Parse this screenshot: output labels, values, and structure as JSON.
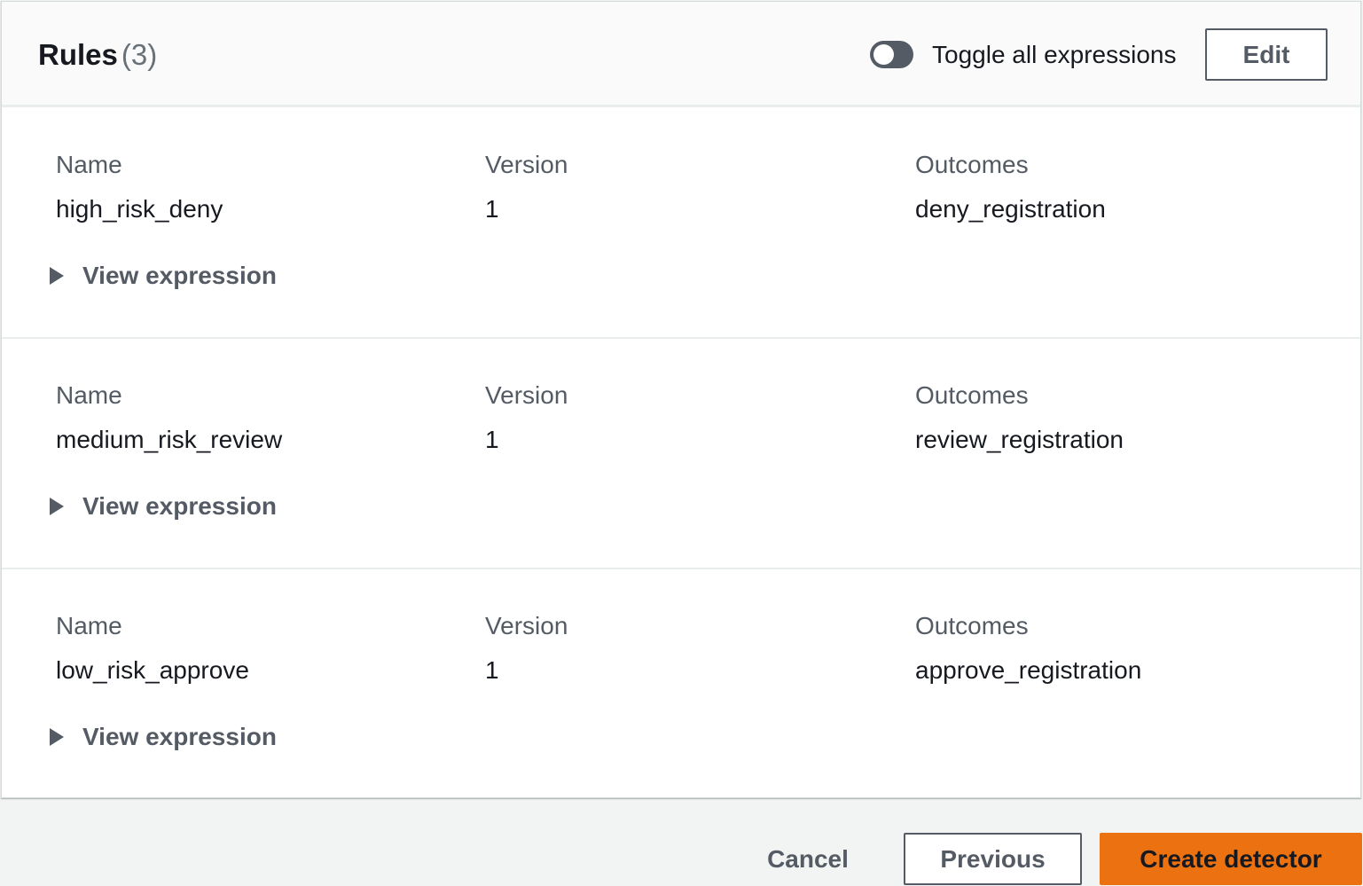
{
  "panel": {
    "title": "Rules",
    "count": "(3)",
    "toggle_label": "Toggle all expressions",
    "toggle_on": false,
    "edit_label": "Edit"
  },
  "rules": [
    {
      "name_label": "Name",
      "name": "high_risk_deny",
      "version_label": "Version",
      "version": "1",
      "outcomes_label": "Outcomes",
      "outcomes": "deny_registration",
      "expander_label": "View expression"
    },
    {
      "name_label": "Name",
      "name": "medium_risk_review",
      "version_label": "Version",
      "version": "1",
      "outcomes_label": "Outcomes",
      "outcomes": "review_registration",
      "expander_label": "View expression"
    },
    {
      "name_label": "Name",
      "name": "low_risk_approve",
      "version_label": "Version",
      "version": "1",
      "outcomes_label": "Outcomes",
      "outcomes": "approve_registration",
      "expander_label": "View expression"
    }
  ],
  "footer": {
    "cancel_label": "Cancel",
    "previous_label": "Previous",
    "create_label": "Create detector"
  },
  "colors": {
    "primary_button": "#ec7211",
    "toggle_off": "#545b64",
    "secondary_text": "#545b64"
  },
  "icons": {
    "expander": "caret-right-icon"
  }
}
